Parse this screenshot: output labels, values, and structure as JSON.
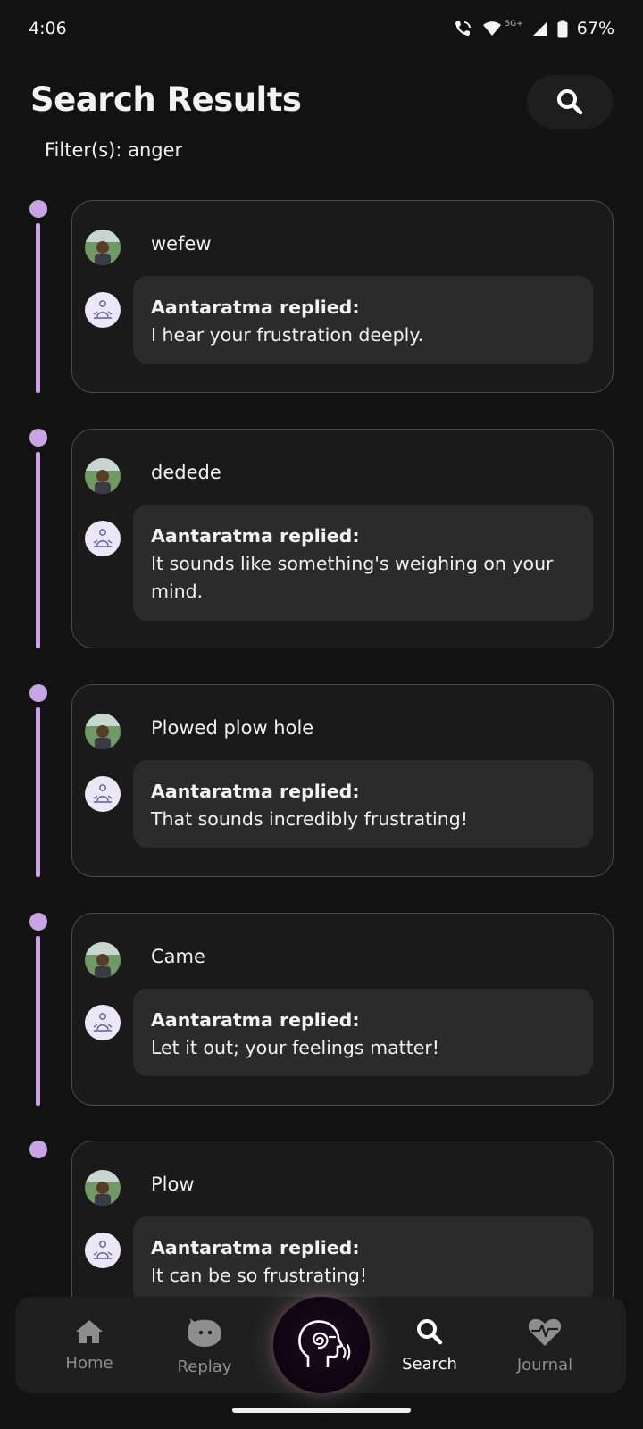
{
  "status_bar": {
    "time": "4:06",
    "network": "5G+",
    "battery": "67%"
  },
  "header": {
    "title": "Search Results",
    "filter_text": "Filter(s): anger"
  },
  "results": [
    {
      "user_message": "wefew",
      "reply_label": "Aantaratma replied:",
      "reply_text": "I hear your frustration deeply."
    },
    {
      "user_message": "dedede",
      "reply_label": "Aantaratma replied:",
      "reply_text": "It sounds like something's weighing on your mind."
    },
    {
      "user_message": "Plowed plow hole",
      "reply_label": "Aantaratma replied:",
      "reply_text": "That sounds incredibly frustrating!"
    },
    {
      "user_message": "Came",
      "reply_label": "Aantaratma replied:",
      "reply_text": "Let it out; your feelings matter!"
    },
    {
      "user_message": "Plow",
      "reply_label": "Aantaratma replied:",
      "reply_text": "It can be so frustrating!"
    }
  ],
  "nav": {
    "home": "Home",
    "replay": "Replay",
    "search": "Search",
    "journal": "Journal"
  },
  "colors": {
    "accent": "#c9a3e6",
    "background": "#121212",
    "card": "#1a1a1a",
    "bubble": "#2b2b2b"
  },
  "icons": {
    "search": "search-icon",
    "home": "home-icon",
    "replay": "replay-face-icon",
    "journal": "heartbeat-icon",
    "center": "head-spiral-icon"
  }
}
